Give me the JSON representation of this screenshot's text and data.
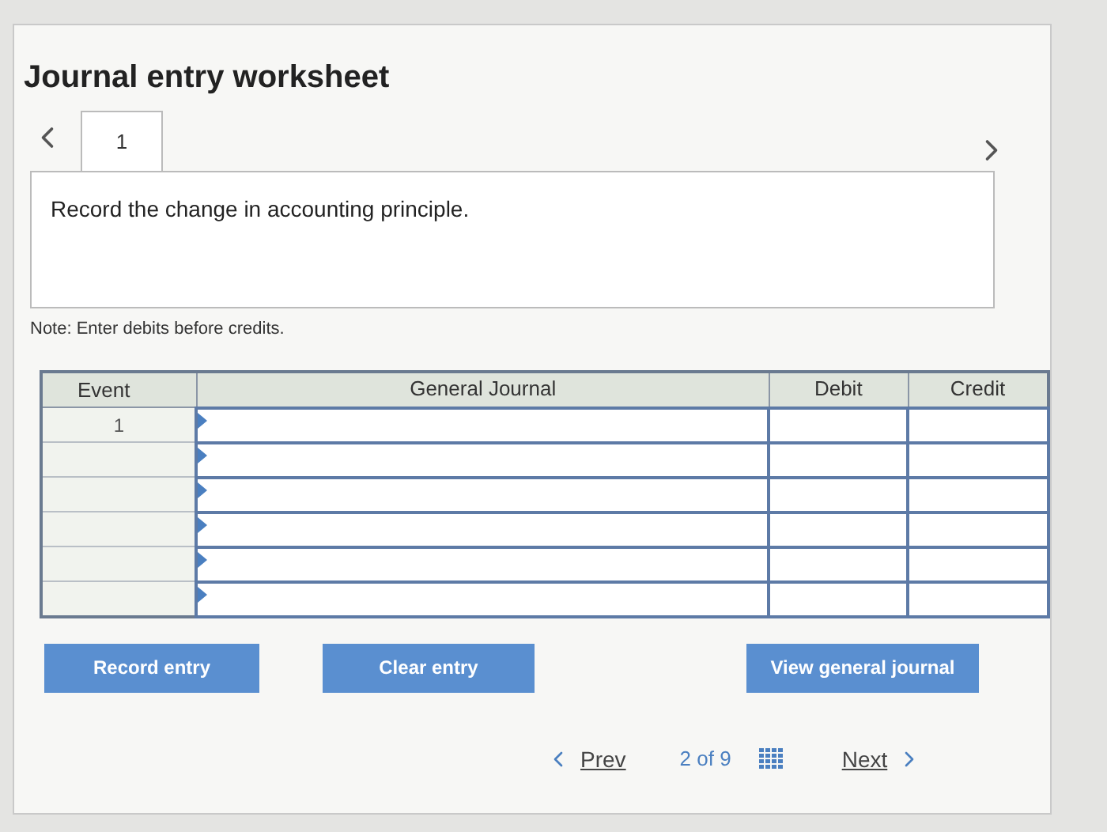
{
  "title": "Journal entry worksheet",
  "tabs": [
    {
      "label": "1",
      "selected": true
    }
  ],
  "instruction": "Record the change in accounting principle.",
  "note": "Note: Enter debits before credits.",
  "table": {
    "columns": [
      "Event",
      "General Journal",
      "Debit",
      "Credit"
    ],
    "rows": [
      {
        "event": "1"
      },
      {},
      {},
      {},
      {},
      {}
    ]
  },
  "buttons": [
    "Record entry",
    "Clear entry",
    "View general journal"
  ],
  "pager": {
    "prev": "Prev",
    "position": "2 of 9",
    "next": "Next"
  }
}
